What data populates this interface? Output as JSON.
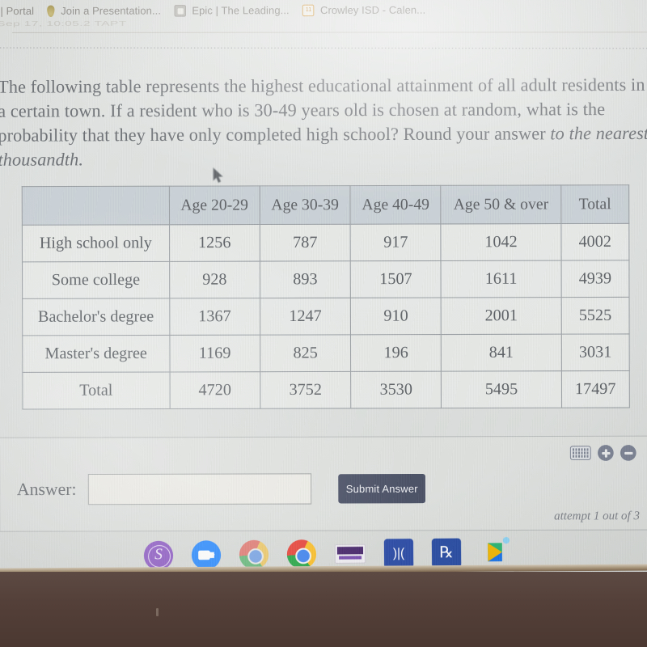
{
  "browser": {
    "bookmarks": [
      {
        "label": "ever | Portal",
        "icon": ""
      },
      {
        "label": "Join a Presentation...",
        "icon": "pin-icon"
      },
      {
        "label": "Epic | The Leading...",
        "icon": "epic-icon"
      },
      {
        "label": "Crowley ISD - Calen...",
        "icon": "calendar-icon"
      }
    ],
    "ghost_line": "Sep 17, 10:05.2 TAPT"
  },
  "question": {
    "line1": "The following table represents the highest educational attainment of all adult",
    "line2": "residents in a certain town. If a resident who is 30-49 years old is chosen at random,",
    "line3": "what is the probability that they have only completed high school? Round your",
    "line4_prefix": "answer ",
    "line4_italic": "to the nearest thousandth."
  },
  "table": {
    "corner": "",
    "columns": [
      "Age 20-29",
      "Age 30-39",
      "Age 40-49",
      "Age 50 & over",
      "Total"
    ],
    "rows": [
      {
        "label": "High school only",
        "values": [
          "1256",
          "787",
          "917",
          "1042",
          "4002"
        ]
      },
      {
        "label": "Some college",
        "values": [
          "928",
          "893",
          "1507",
          "1611",
          "4939"
        ]
      },
      {
        "label": "Bachelor's degree",
        "values": [
          "1367",
          "1247",
          "910",
          "2001",
          "5525"
        ]
      },
      {
        "label": "Master's degree",
        "values": [
          "1169",
          "825",
          "196",
          "841",
          "3031"
        ]
      }
    ],
    "total_row": {
      "label": "Total",
      "values": [
        "4720",
        "3752",
        "3530",
        "5495",
        "17497"
      ]
    }
  },
  "answer_panel": {
    "label": "Answer:",
    "input_value": "",
    "input_placeholder": "",
    "submit_label": "Submit Answer",
    "attempt": "attempt 1 out of 3",
    "tools": [
      "keyboard-icon",
      "zoom-in-icon",
      "zoom-out-icon"
    ]
  },
  "shelf": {
    "items": [
      "seesaw-icon",
      "zoom-meetings-icon",
      "chrome-icon",
      "chrome-active-icon",
      "document-icon",
      "speaker-icon",
      "rx-icon",
      "play-store-icon"
    ]
  },
  "colors": {
    "screen_bg": "#dfe2e0",
    "table_header_bg": "#bac4cd",
    "table_border": "#9ba0a4",
    "submit_bg": "#4c5267",
    "text": "#6e7175",
    "desk": "#52403a"
  }
}
